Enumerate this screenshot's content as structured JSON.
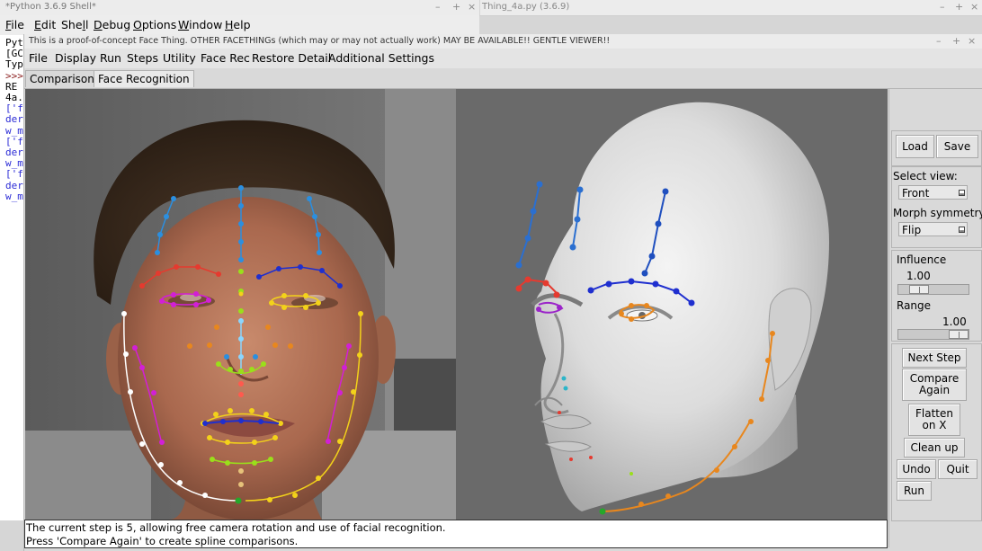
{
  "shell": {
    "title": "*Python 3.6.9 Shell*",
    "menu": [
      {
        "mn": "F",
        "rest": "ile"
      },
      {
        "mn": "E",
        "rest": "dit"
      },
      {
        "pre": "She",
        "mn": "l",
        "rest": "l"
      },
      {
        "mn": "D",
        "rest": "ebug"
      },
      {
        "mn": "O",
        "rest": "ptions"
      },
      {
        "mn": "W",
        "rest": "indow"
      },
      {
        "mn": "H",
        "rest": "elp"
      }
    ],
    "lines": [
      {
        "t": "Pyt",
        "c": "#000"
      },
      {
        "t": "[GC",
        "c": "#000"
      },
      {
        "t": "Typ",
        "c": "#000"
      },
      {
        "t": ">>>",
        "c": "#8a1c1c"
      },
      {
        "t": " RE",
        "c": "#000"
      },
      {
        "t": "4a.",
        "c": "#000"
      },
      {
        "t": "['f",
        "c": "#2b2bd6"
      },
      {
        "t": "der",
        "c": "#2b2bd6"
      },
      {
        "t": "w_m",
        "c": "#2b2bd6"
      },
      {
        "t": "['f",
        "c": "#2b2bd6"
      },
      {
        "t": "der",
        "c": "#2b2bd6"
      },
      {
        "t": "w_m",
        "c": "#2b2bd6"
      },
      {
        "t": "['f",
        "c": "#2b2bd6"
      },
      {
        "t": "der",
        "c": "#2b2bd6"
      },
      {
        "t": "w_m",
        "c": "#2b2bd6"
      }
    ]
  },
  "thing_window": {
    "title": "Thing_4a.py (3.6.9)"
  },
  "window_buttons": {
    "minimize": "–",
    "maximize": "+",
    "close": "×"
  },
  "main": {
    "title": "This is a proof-of-concept Face Thing.  OTHER FACETHINGs (which may or may not actually work) MAY BE AVAILABLE!!  GENTLE VIEWER!!",
    "menu": [
      "File",
      "Display",
      "Run",
      "Steps",
      "Utility",
      "Face Rec",
      "Restore Detail",
      "Additional Settings"
    ],
    "tabs": [
      "Comparisons",
      "Face Recognition"
    ],
    "active_tab": 1
  },
  "side": {
    "load": "Load",
    "save": "Save",
    "select_view_label": "Select view:",
    "view_value": "Front",
    "morph_label": "Morph symmetry:",
    "morph_value": "Flip",
    "influence_label": "Influence",
    "influence_value": "1.00",
    "influence_level": 0.22,
    "range_label": "Range",
    "range_value": "1.00",
    "range_level": 1.0,
    "next_step": "Next Step",
    "compare_again": "Compare Again",
    "flatten": "Flatten on X",
    "clean_up": "Clean up",
    "undo": "Undo",
    "quit": "Quit",
    "run": "Run"
  },
  "status": {
    "line1": "The current step is 5, allowing free camera rotation and use of facial recognition.",
    "line2": "Press 'Compare Again' to create spline comparisons."
  },
  "colors": {
    "landmark_red": "#e53a2f",
    "landmark_blue": "#1f2fcf",
    "landmark_lightblue": "#2b8fe0",
    "landmark_magenta": "#d21fd6",
    "landmark_yellow": "#f3d21a",
    "landmark_orange": "#e8871e",
    "landmark_green": "#25a82a",
    "landmark_lime": "#9adf1a",
    "landmark_white": "#ffffff",
    "landmark_purple": "#9b24c9"
  }
}
